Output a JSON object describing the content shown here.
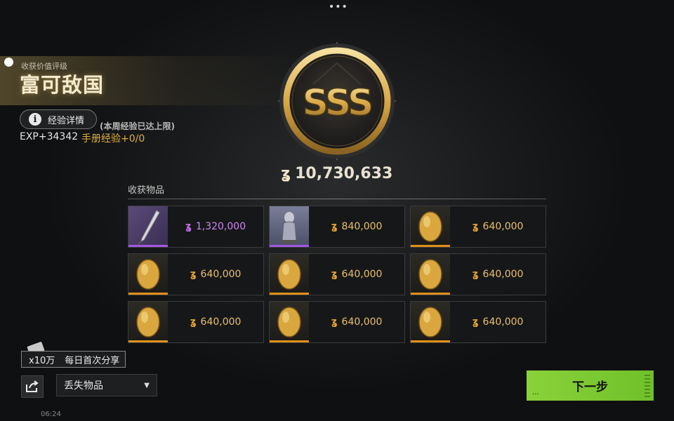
{
  "header": {
    "menu_dots": "•••"
  },
  "grade": {
    "caption": "收获价值评级",
    "title": "富可敌国",
    "rank": "SSS"
  },
  "experience": {
    "details_button": "经验详情",
    "weekly_cap_note": "(本周经验已达上限)",
    "exp_gain": "EXP+34342",
    "handbook_exp": "手册经验+0/0"
  },
  "total": {
    "value": "10,730,633",
    "currency_icon": "coin-icon"
  },
  "items": {
    "title": "收获物品",
    "list": [
      {
        "name": "knife",
        "price": "1,320,000",
        "quality": "purple"
      },
      {
        "name": "figurine",
        "price": "840,000",
        "quality": "silver"
      },
      {
        "name": "golden-egg",
        "price": "640,000",
        "quality": "gold"
      },
      {
        "name": "golden-egg",
        "price": "640,000",
        "quality": "gold"
      },
      {
        "name": "golden-egg",
        "price": "640,000",
        "quality": "gold"
      },
      {
        "name": "golden-egg",
        "price": "640,000",
        "quality": "gold"
      },
      {
        "name": "golden-egg",
        "price": "640,000",
        "quality": "gold"
      },
      {
        "name": "golden-egg",
        "price": "640,000",
        "quality": "gold"
      },
      {
        "name": "golden-egg",
        "price": "640,000",
        "quality": "gold"
      }
    ]
  },
  "share": {
    "multiplier": "x10万",
    "label": "每日首次分享"
  },
  "dropdown": {
    "selected": "丢失物品"
  },
  "footer": {
    "time": "06:24"
  },
  "next_button": {
    "label": "下一步",
    "dots": "..."
  },
  "colors": {
    "accent_gold": "#e0a032",
    "purple": "#c070e8",
    "next_green": "#7ccb30"
  }
}
